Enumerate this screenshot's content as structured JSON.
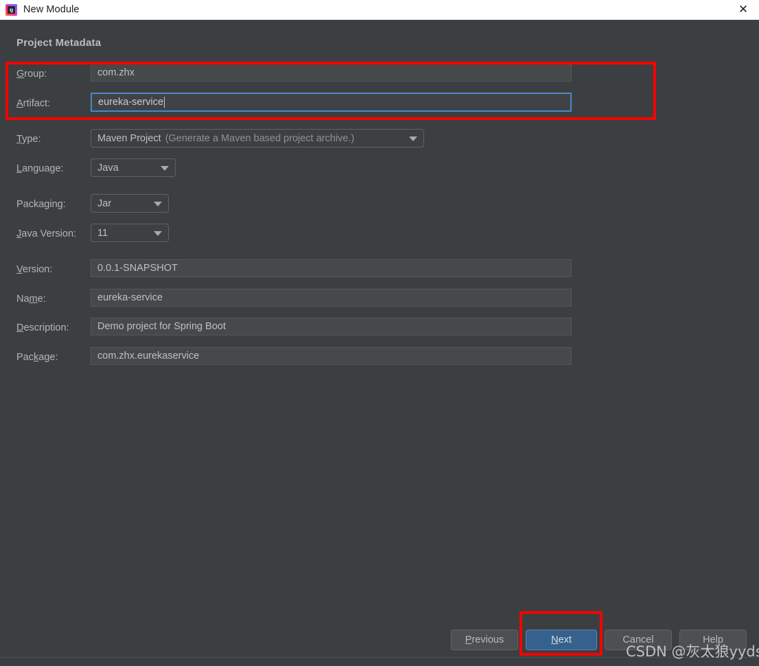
{
  "window": {
    "title": "New Module",
    "app_icon": "intellij-idea-icon",
    "close_icon": "close-icon"
  },
  "section": {
    "title": "Project Metadata"
  },
  "fields": {
    "group": {
      "label": "Group:",
      "mnemonic": "G",
      "value": "com.zhx",
      "type": "text"
    },
    "artifact": {
      "label": "Artifact:",
      "mnemonic": "A",
      "value": "eureka-service",
      "type": "text",
      "focused": true
    },
    "type": {
      "label": "Type:",
      "mnemonic": "T",
      "value": "Maven Project",
      "value_hint": "(Generate a Maven based project archive.)",
      "type": "combo"
    },
    "language": {
      "label": "Language:",
      "mnemonic": "L",
      "value": "Java",
      "type": "combo"
    },
    "packaging": {
      "label": "Packaging:",
      "mnemonic": "",
      "value": "Jar",
      "type": "combo"
    },
    "java_version": {
      "label": "Java Version:",
      "mnemonic": "J",
      "value": "11",
      "type": "combo"
    },
    "version": {
      "label": "Version:",
      "mnemonic": "V",
      "value": "0.0.1-SNAPSHOT",
      "type": "text"
    },
    "name": {
      "label": "Name:",
      "mnemonic": "m",
      "value": "eureka-service",
      "type": "text"
    },
    "description": {
      "label": "Description:",
      "mnemonic": "D",
      "value": "Demo project for Spring Boot",
      "type": "text"
    },
    "package": {
      "label": "Package:",
      "mnemonic": "k",
      "value": "com.zhx.eurekaservice",
      "type": "text"
    }
  },
  "buttons": {
    "previous": "Previous",
    "next": "Next",
    "cancel": "Cancel",
    "help": "Help"
  },
  "watermark": {
    "text": "CSDN @灰太狼yyds"
  },
  "colors": {
    "background": "#3c3f41",
    "titlebar": "#ffffff",
    "field": "#45494a",
    "focus_border": "#4a88c7",
    "primary_button": "#36618e",
    "annotation": "#fe0000",
    "text": "#b2b6b8"
  }
}
